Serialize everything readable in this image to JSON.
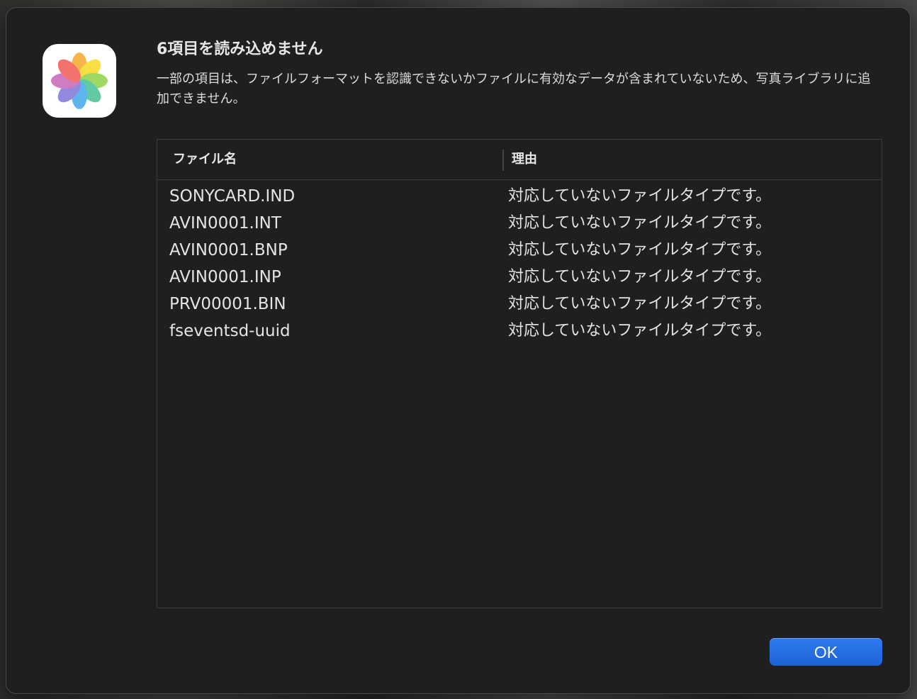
{
  "dialog": {
    "title": "6項目を読み込めません",
    "message": "一部の項目は、ファイルフォーマットを認識できないかファイルに有効なデータが含まれていないため、写真ライブラリに追加できません。",
    "app_icon": "photos-app-icon"
  },
  "table": {
    "columns": {
      "name": "ファイル名",
      "reason": "理由"
    },
    "rows": [
      {
        "name": "SONYCARD.IND",
        "reason": "対応していないファイルタイプです。"
      },
      {
        "name": "AVIN0001.INT",
        "reason": "対応していないファイルタイプです。"
      },
      {
        "name": "AVIN0001.BNP",
        "reason": "対応していないファイルタイプです。"
      },
      {
        "name": "AVIN0001.INP",
        "reason": "対応していないファイルタイプです。"
      },
      {
        "name": "PRV00001.BIN",
        "reason": "対応していないファイルタイプです。"
      },
      {
        "name": "fseventsd-uuid",
        "reason": "対応していないファイルタイプです。"
      }
    ]
  },
  "buttons": {
    "ok_label": "OK"
  },
  "colors": {
    "dialog_background": "#1f1f1f",
    "accent": "#1d62d6"
  }
}
